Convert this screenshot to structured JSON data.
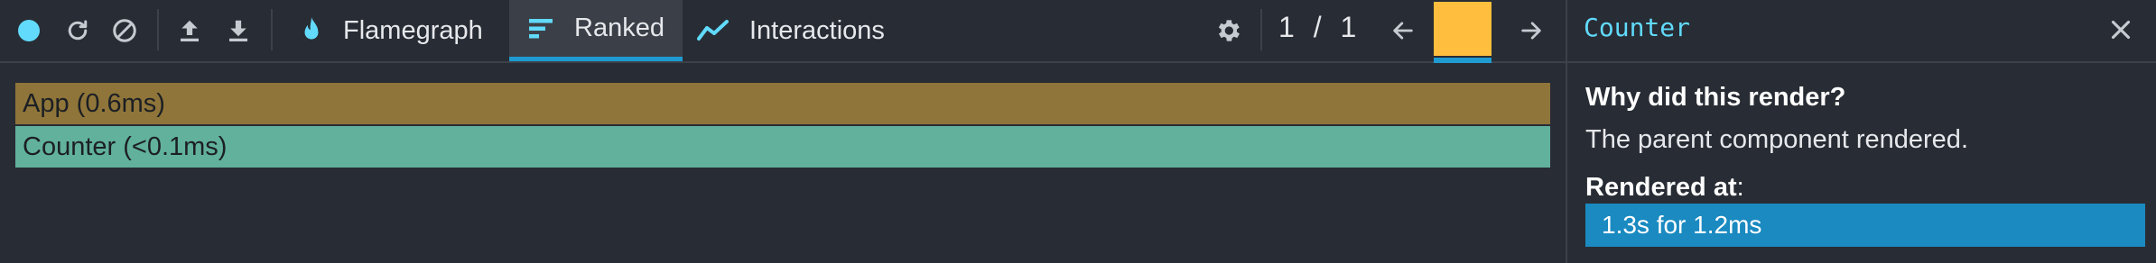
{
  "toolbar": {
    "record_icon": "record-dot-icon",
    "reload_icon": "reload-and-profile-icon",
    "clear_icon": "clear-profile-icon",
    "load_icon": "load-profile-icon",
    "save_icon": "save-profile-icon",
    "tabs": [
      {
        "label": "Flamegraph",
        "icon": "flame-icon",
        "active": false
      },
      {
        "label": "Ranked",
        "icon": "ranked-icon",
        "active": true
      },
      {
        "label": "Interactions",
        "icon": "interactions-icon",
        "active": false
      }
    ],
    "settings_icon": "gear-icon",
    "commit_counter": "1 / 1",
    "prev_icon": "arrow-left-icon",
    "next_icon": "arrow-right-icon",
    "commit_color": "#ffbe3d"
  },
  "ranked": {
    "items": [
      {
        "label": "App (0.6ms)",
        "color": "#8f7539"
      },
      {
        "label": "Counter (<0.1ms)",
        "color": "#61b19d"
      }
    ]
  },
  "sidebar": {
    "title": "Counter",
    "close_icon": "close-icon",
    "why_heading": "Why did this render?",
    "why_text": "The parent component rendered.",
    "rendered_at_label": "Rendered at",
    "rendered_at_colon": ":",
    "rendered_at_items": [
      "1.3s for 1.2ms"
    ]
  },
  "colors": {
    "background": "#282c34",
    "accent": "#1f9bd1",
    "record": "#61dafb"
  }
}
